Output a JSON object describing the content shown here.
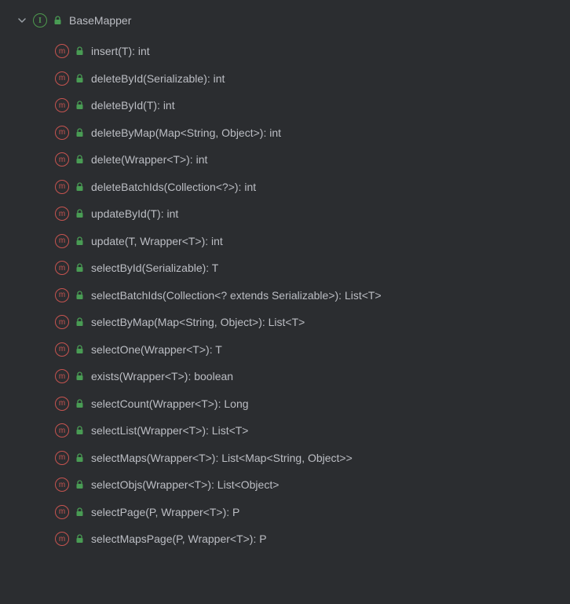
{
  "root": {
    "label": "BaseMapper"
  },
  "methods": [
    {
      "label": "insert(T): int"
    },
    {
      "label": "deleteById(Serializable): int"
    },
    {
      "label": "deleteById(T): int"
    },
    {
      "label": "deleteByMap(Map<String, Object>): int"
    },
    {
      "label": "delete(Wrapper<T>): int"
    },
    {
      "label": "deleteBatchIds(Collection<?>): int"
    },
    {
      "label": "updateById(T): int"
    },
    {
      "label": "update(T, Wrapper<T>): int"
    },
    {
      "label": "selectById(Serializable): T"
    },
    {
      "label": "selectBatchIds(Collection<? extends Serializable>): List<T>"
    },
    {
      "label": "selectByMap(Map<String, Object>): List<T>"
    },
    {
      "label": "selectOne(Wrapper<T>): T"
    },
    {
      "label": "exists(Wrapper<T>): boolean"
    },
    {
      "label": "selectCount(Wrapper<T>): Long"
    },
    {
      "label": "selectList(Wrapper<T>): List<T>"
    },
    {
      "label": "selectMaps(Wrapper<T>): List<Map<String, Object>>"
    },
    {
      "label": "selectObjs(Wrapper<T>): List<Object>"
    },
    {
      "label": "selectPage(P, Wrapper<T>): P"
    },
    {
      "label": "selectMapsPage(P, Wrapper<T>): P"
    }
  ]
}
